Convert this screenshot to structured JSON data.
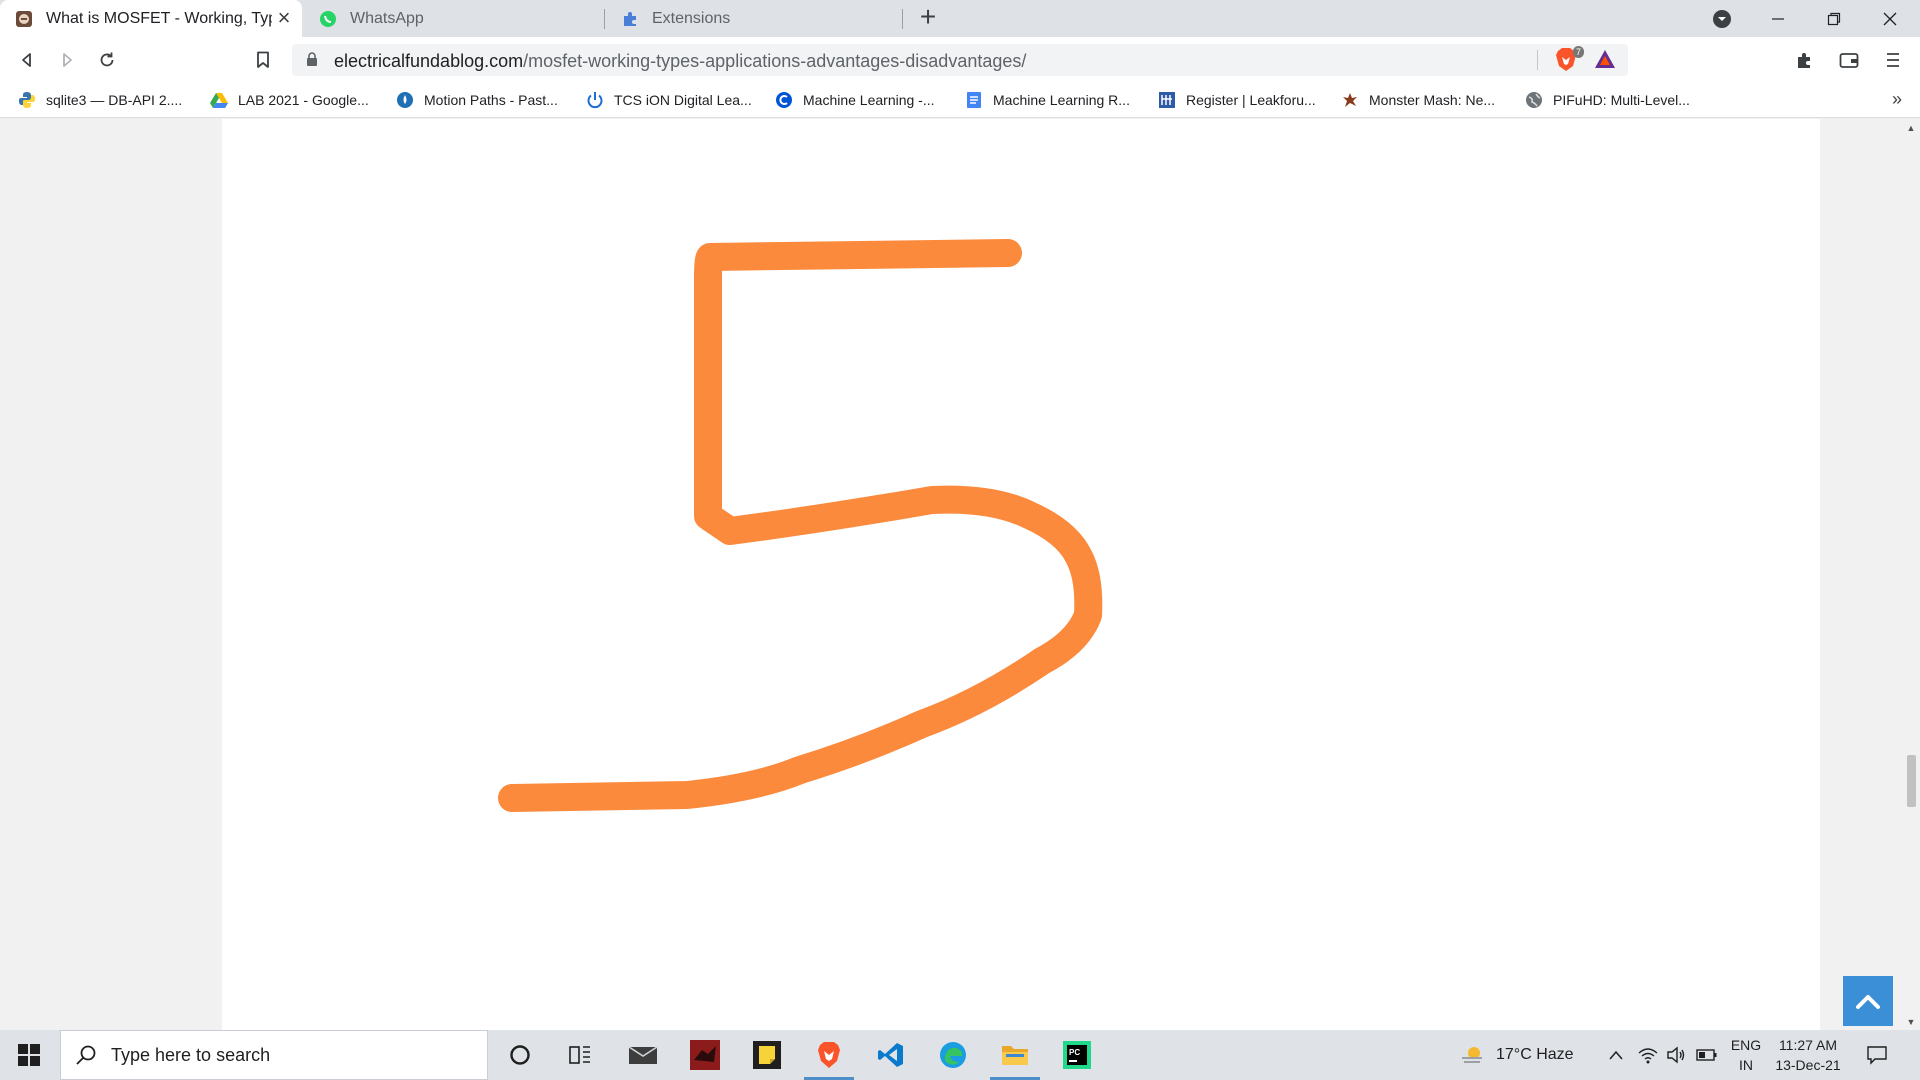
{
  "browser": {
    "tabs": [
      {
        "title": "What is MOSFET - Working, Types",
        "active": true,
        "icon": "site-favicon"
      },
      {
        "title": "WhatsApp",
        "active": false,
        "icon": "whatsapp-icon"
      },
      {
        "title": "Extensions",
        "active": false,
        "icon": "puzzle-icon"
      }
    ],
    "url_domain": "electricalfundablog.com",
    "url_path": "/mosfet-working-types-applications-advantages-disadvantages/",
    "brave_shield_count": "7"
  },
  "bookmarks": [
    {
      "label": "sqlite3 — DB-API 2....",
      "icon": "python-icon"
    },
    {
      "label": "LAB 2021 - Google...",
      "icon": "google-drive-icon"
    },
    {
      "label": "Motion Paths - Past...",
      "icon": "drop-icon"
    },
    {
      "label": "TCS iON Digital Lea...",
      "icon": "power-icon"
    },
    {
      "label": "Machine Learning -...",
      "icon": "coursera-icon"
    },
    {
      "label": "Machine Learning R...",
      "icon": "doc-icon"
    },
    {
      "label": "Register | Leakforu...",
      "icon": "leakforum-icon"
    },
    {
      "label": "Monster Mash: Ne...",
      "icon": "monster-icon"
    },
    {
      "label": "PIFuHD: Multi-Level...",
      "icon": "globe-icon"
    }
  ],
  "page": {
    "stroke_color": "#fb8a3c"
  },
  "taskbar": {
    "search_placeholder": "Type here to search",
    "weather": "17°C  Haze",
    "lang_line1": "ENG",
    "lang_line2": "IN",
    "time": "11:27 AM",
    "date": "13-Dec-21"
  }
}
